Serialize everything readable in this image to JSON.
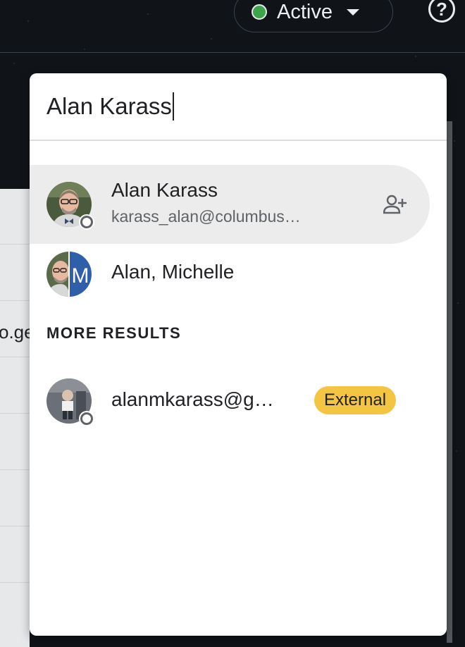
{
  "header": {
    "status_label": "Active",
    "status_color": "#3fa34d",
    "help_glyph": "?"
  },
  "background": {
    "partial_text": "o.ge"
  },
  "search": {
    "value": "Alan Karass"
  },
  "results": [
    {
      "name": "Alan Karass",
      "email": "karass_alan@columbus…",
      "presence": "offline",
      "action_icon": "add-person-icon",
      "highlighted": true
    },
    {
      "name": "Alan, Michelle",
      "avatar_letter": "M",
      "group": true
    }
  ],
  "more_results": {
    "label": "MORE RESULTS",
    "items": [
      {
        "name": "alanmkarass@g…",
        "badge": "External",
        "badge_color": "#f4c542",
        "presence": "offline"
      }
    ]
  }
}
